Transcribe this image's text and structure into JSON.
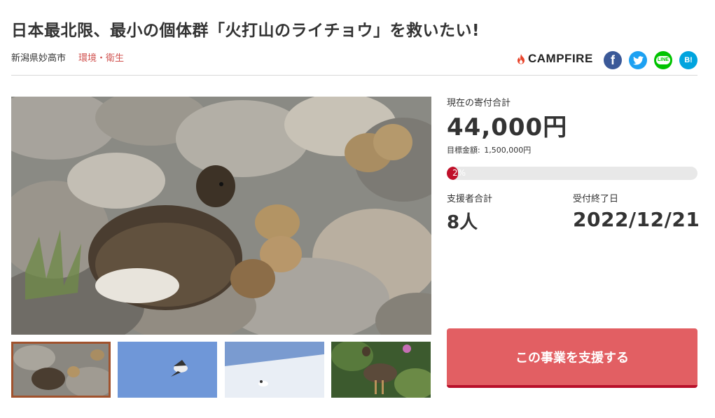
{
  "project": {
    "title": "日本最北限、最小の個体群「火打山のライチョウ」を救いたい!",
    "location": "新潟県妙高市",
    "category": "環境・衛生"
  },
  "brand": {
    "name": "CAMPFIRE"
  },
  "share": {
    "facebook_icon": "f",
    "line_label": "LINE",
    "hatena_label": "B!"
  },
  "stats": {
    "total_label": "現在の寄付合計",
    "total_amount": "44,000円",
    "goal_label": "目標金額:",
    "goal_amount": "1,500,000円",
    "progress_text": "2%",
    "progress_value": 0.029,
    "supporters_label": "支援者合計",
    "supporters": "8人",
    "end_label": "受付終了日",
    "end_date": "2022/12/21"
  },
  "cta": {
    "label": "この事業を支援する"
  },
  "gallery": {
    "selected_index": 0,
    "thumbnails": [
      "ptarmigan-hen-with-chicks",
      "bird-in-flight-blue-sky",
      "bird-on-snow",
      "ptarmigan-among-flowers"
    ]
  },
  "colors": {
    "category": "#d0524f",
    "cta_bg": "#e25f63",
    "cta_border": "#b8102a",
    "progress": "#c0102a",
    "thumb_border": "#a0522d"
  }
}
